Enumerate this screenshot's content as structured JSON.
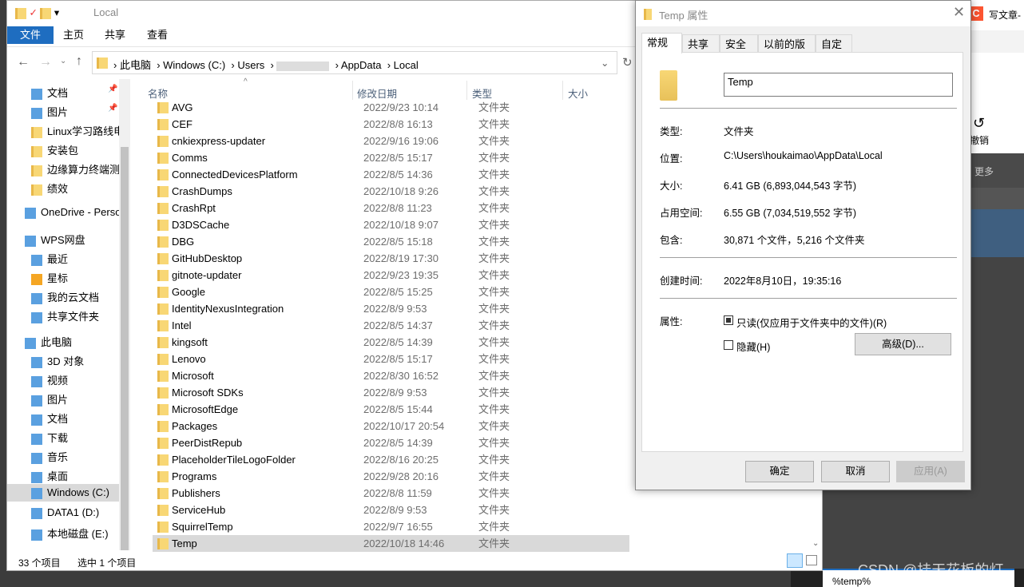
{
  "explorer": {
    "title": "Local",
    "ribbon_tabs": [
      "文件",
      "主页",
      "共享",
      "查看"
    ],
    "breadcrumb": [
      "此电脑",
      "Windows (C:)",
      "Users",
      "",
      "AppData",
      "Local"
    ],
    "columns": {
      "name": "名称",
      "date": "修改日期",
      "type": "类型",
      "size": "大小"
    },
    "sidebar": [
      {
        "label": "文档",
        "icon": "document-icon",
        "pinned": true
      },
      {
        "label": "图片",
        "icon": "pictures-icon",
        "pinned": true
      },
      {
        "label": "Linux学习路线电",
        "icon": "folder-icon"
      },
      {
        "label": "安装包",
        "icon": "folder-icon"
      },
      {
        "label": "边缘算力终端测",
        "icon": "folder-icon"
      },
      {
        "label": "绩效",
        "icon": "folder-icon"
      },
      {
        "label": "OneDrive - Perso",
        "icon": "onedrive-icon"
      },
      {
        "label": "WPS网盘",
        "icon": "wps-cloud-icon"
      },
      {
        "label": "最近",
        "icon": "recent-icon"
      },
      {
        "label": "星标",
        "icon": "star-icon"
      },
      {
        "label": "我的云文档",
        "icon": "cloud-docs-icon"
      },
      {
        "label": "共享文件夹",
        "icon": "shared-folder-icon"
      },
      {
        "label": "此电脑",
        "icon": "this-pc-icon"
      },
      {
        "label": "3D 对象",
        "icon": "3d-objects-icon"
      },
      {
        "label": "视频",
        "icon": "video-icon"
      },
      {
        "label": "图片",
        "icon": "pictures-icon"
      },
      {
        "label": "文档",
        "icon": "document-icon"
      },
      {
        "label": "下载",
        "icon": "download-icon"
      },
      {
        "label": "音乐",
        "icon": "music-icon"
      },
      {
        "label": "桌面",
        "icon": "desktop-icon"
      },
      {
        "label": "Windows (C:)",
        "icon": "drive-icon",
        "selected": true
      },
      {
        "label": "DATA1 (D:)",
        "icon": "drive-icon"
      },
      {
        "label": "本地磁盘 (E:)",
        "icon": "drive-icon"
      }
    ],
    "files": [
      [
        "AVG",
        "2022/9/23 10:14"
      ],
      [
        "CEF",
        "2022/8/8 16:13"
      ],
      [
        "cnkiexpress-updater",
        "2022/9/16 19:06"
      ],
      [
        "Comms",
        "2022/8/5 15:17"
      ],
      [
        "ConnectedDevicesPlatform",
        "2022/8/5 14:36"
      ],
      [
        "CrashDumps",
        "2022/10/18 9:26"
      ],
      [
        "CrashRpt",
        "2022/8/8 11:23"
      ],
      [
        "D3DSCache",
        "2022/10/18 9:07"
      ],
      [
        "DBG",
        "2022/8/5 15:18"
      ],
      [
        "GitHubDesktop",
        "2022/8/19 17:30"
      ],
      [
        "gitnote-updater",
        "2022/9/23 19:35"
      ],
      [
        "Google",
        "2022/8/5 15:25"
      ],
      [
        "IdentityNexusIntegration",
        "2022/8/9 9:53"
      ],
      [
        "Intel",
        "2022/8/5 14:37"
      ],
      [
        "kingsoft",
        "2022/8/5 14:39"
      ],
      [
        "Lenovo",
        "2022/8/5 15:17"
      ],
      [
        "Microsoft",
        "2022/8/30 16:52"
      ],
      [
        "Microsoft SDKs",
        "2022/8/9 9:53"
      ],
      [
        "MicrosoftEdge",
        "2022/8/5 15:44"
      ],
      [
        "Packages",
        "2022/10/17 20:54"
      ],
      [
        "PeerDistRepub",
        "2022/8/5 14:39"
      ],
      [
        "PlaceholderTileLogoFolder",
        "2022/8/16 20:25"
      ],
      [
        "Programs",
        "2022/9/28 20:16"
      ],
      [
        "Publishers",
        "2022/8/8 11:59"
      ],
      [
        "ServiceHub",
        "2022/8/9 9:53"
      ],
      [
        "SquirrelTemp",
        "2022/9/7 16:55"
      ],
      [
        "Temp",
        "2022/10/18 14:46"
      ]
    ],
    "file_type": "文件夹",
    "selected_file": "Temp",
    "status": {
      "count": "33 个项目",
      "selected": "选中 1 个项目"
    }
  },
  "dialog": {
    "title": "Temp 属性",
    "tabs": [
      "常规",
      "共享",
      "安全",
      "以前的版本",
      "自定义"
    ],
    "name_value": "Temp",
    "type_label": "类型:",
    "type_value": "文件夹",
    "location_label": "位置:",
    "location_value": "C:\\Users\\houkaimao\\AppData\\Local",
    "size_label": "大小:",
    "size_value": "6.41 GB (6,893,044,543 字节)",
    "disk_label": "占用空间:",
    "disk_value": "6.55 GB (7,034,519,552 字节)",
    "contains_label": "包含:",
    "contains_value": "30,871 个文件，5,216 个文件夹",
    "created_label": "创建时间:",
    "created_value": "2022年8月10日，19:35:16",
    "attr_label": "属性:",
    "readonly_label": "只读(仅应用于文件夹中的文件)(R)",
    "readonly_checked": "indeterminate",
    "hidden_label": "隐藏(H)",
    "hidden_checked": false,
    "advanced": "高级(D)...",
    "ok": "确定",
    "cancel": "取消",
    "apply": "应用(A)"
  },
  "background": {
    "csdn_title": "写文章-",
    "undo": "撤销",
    "more": "更多",
    "search_text": "%temp%",
    "watermark": "CSDN @挂天花板的灯"
  },
  "colors": {
    "accent": "#1e6dc0",
    "selected_row": "#d9d9d9",
    "csdn": "#fc5531"
  }
}
